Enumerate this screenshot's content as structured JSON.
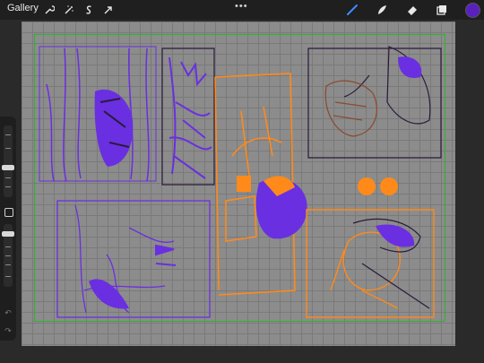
{
  "toolbar": {
    "gallery_label": "Gallery",
    "left_tools": [
      "wrench-icon",
      "magic-wand-icon",
      "selection-s-icon",
      "transform-arrow-icon"
    ],
    "more_label": "•••",
    "right_tools": [
      "brush-icon",
      "smudge-icon",
      "eraser-icon",
      "layers-icon"
    ],
    "active_color": "#5a1fbf",
    "active_tool_color": "#3b8cff"
  },
  "canvas": {
    "background": "#8c8c8c",
    "guide_color": "#2bb52b",
    "sketch_colors": {
      "purple": "#6a2fe0",
      "orange": "#ff8a1a",
      "dark": "#2a1a3a",
      "brown": "#8a4a2a"
    }
  }
}
